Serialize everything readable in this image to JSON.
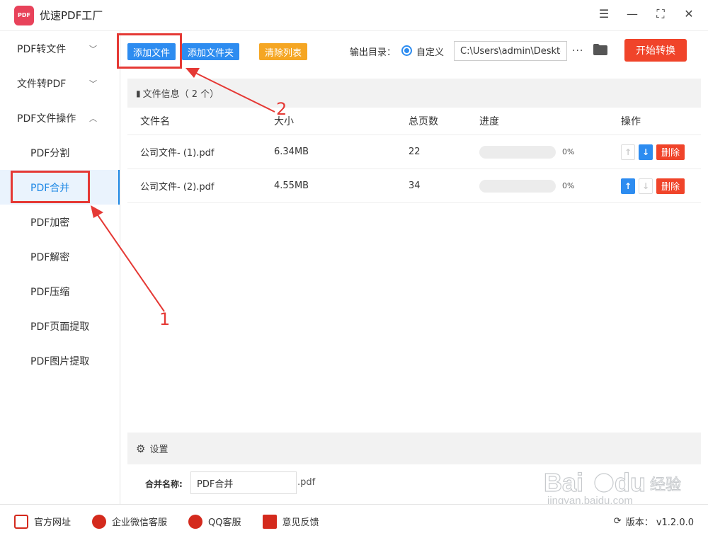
{
  "app": {
    "title": "优速PDF工厂",
    "logo_text": "PDF"
  },
  "window_controls": [
    "menu-icon",
    "minimize-icon",
    "maximize-icon",
    "close-icon"
  ],
  "sidebar": {
    "groups": [
      {
        "label": "PDF转文件",
        "expanded": false
      },
      {
        "label": "文件转PDF",
        "expanded": false
      },
      {
        "label": "PDF文件操作",
        "expanded": true
      }
    ],
    "items": [
      "PDF分割",
      "PDF合并",
      "PDF加密",
      "PDF解密",
      "PDF压缩",
      "PDF页面提取",
      "PDF图片提取"
    ],
    "active_item": "PDF合并"
  },
  "toolbar": {
    "add_file": "添加文件",
    "add_folder": "添加文件夹",
    "clear_list": "清除列表",
    "output_label": "输出目录：",
    "radio_label": "自定义",
    "output_path": "C:\\Users\\admin\\Deskto",
    "more": "···",
    "start": "开始转换"
  },
  "file_panel": {
    "header": "文件信息（ 2 个）",
    "columns": [
      "文件名",
      "大小",
      "总页数",
      "进度",
      "操作"
    ],
    "rows": [
      {
        "name": "公司文件- (1).pdf",
        "size": "6.34MB",
        "pages": "22",
        "progress": "0%",
        "up_enabled": false,
        "down_enabled": true,
        "delete": "删除"
      },
      {
        "name": "公司文件- (2).pdf",
        "size": "4.55MB",
        "pages": "34",
        "progress": "0%",
        "up_enabled": true,
        "down_enabled": false,
        "delete": "删除"
      }
    ]
  },
  "settings": {
    "title": "设置",
    "merge_label": "合并名称:",
    "merge_value": "PDF合并",
    "merge_ext": ".pdf"
  },
  "footer": {
    "links": [
      "官方网址",
      "企业微信客服",
      "QQ客服",
      "意见反馈"
    ],
    "version": "版本：  v1.2.0.0"
  },
  "annotations": {
    "label_1": "1",
    "label_2": "2",
    "color": "#e53935"
  },
  "colors": {
    "primary": "#2d8cf0",
    "danger": "#f0442a",
    "warning": "#f5a623",
    "active_bg": "#eaf3fd"
  }
}
